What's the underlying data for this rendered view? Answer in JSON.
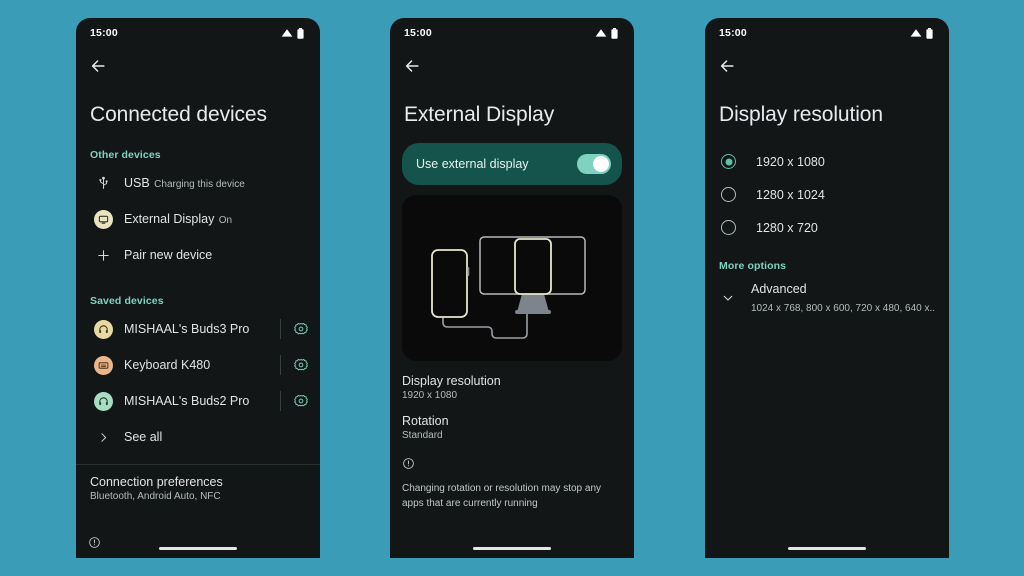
{
  "background_color": "#3a9cb7",
  "theme": {
    "surface": "#121617",
    "accent_teal": "#7fd2c0",
    "card_teal": "#14544c",
    "radio_selected": "#5fbfa8",
    "text_primary": "#e3e3e3",
    "text_secondary": "#b5bcbd"
  },
  "status_bar": {
    "time": "15:00",
    "icons": [
      "wifi-icon",
      "battery-icon"
    ]
  },
  "screens": [
    {
      "id": "connected-devices",
      "back_icon": "back-arrow-icon",
      "title": "Connected devices",
      "sections": [
        {
          "label": "Other devices",
          "rows": [
            {
              "icon": "usb-icon",
              "icon_style": "glyph",
              "title": "USB",
              "subtitle": "Charging this device"
            },
            {
              "icon": "external-display-icon",
              "icon_style": "avatar",
              "avatar_color": "#e9e3c0",
              "title": "External Display",
              "subtitle": "On"
            },
            {
              "icon": "plus-icon",
              "icon_style": "glyph",
              "title": "Pair new device",
              "subtitle": ""
            }
          ]
        },
        {
          "label": "Saved devices",
          "rows": [
            {
              "icon": "headphones-icon",
              "icon_style": "avatar",
              "avatar_color": "#e8d9a0",
              "title": "MISHAAL's Buds3 Pro",
              "subtitle": "",
              "trailing_icon": "gear-icon"
            },
            {
              "icon": "keyboard-icon",
              "icon_style": "avatar",
              "avatar_color": "#eab78a",
              "title": "Keyboard K480",
              "subtitle": "",
              "trailing_icon": "gear-icon"
            },
            {
              "icon": "headphones-icon",
              "icon_style": "avatar",
              "avatar_color": "#a8ddc2",
              "title": "MISHAAL's Buds2 Pro",
              "subtitle": "",
              "trailing_icon": "gear-icon"
            },
            {
              "icon": "chevron-right-icon",
              "icon_style": "glyph",
              "title": "See all",
              "subtitle": ""
            }
          ]
        }
      ],
      "preferences": {
        "title": "Connection preferences",
        "subtitle": "Bluetooth, Android Auto, NFC"
      },
      "corner_icon": "info-icon"
    },
    {
      "id": "external-display",
      "back_icon": "back-arrow-icon",
      "title": "External Display",
      "toggle": {
        "label": "Use external display",
        "state": "on"
      },
      "illustration": "phone-connected-to-monitor-illustration",
      "items": [
        {
          "title": "Display resolution",
          "subtitle": "1920 x 1080"
        },
        {
          "title": "Rotation",
          "subtitle": "Standard"
        }
      ],
      "note": {
        "icon": "info-icon",
        "text": "Changing rotation or resolution may stop any apps that are currently running"
      }
    },
    {
      "id": "display-resolution",
      "back_icon": "back-arrow-icon",
      "title": "Display resolution",
      "options": [
        {
          "label": "1920 x 1080",
          "selected": true
        },
        {
          "label": "1280 x 1024",
          "selected": false
        },
        {
          "label": "1280 x 720",
          "selected": false
        }
      ],
      "more_options_label": "More options",
      "advanced": {
        "chevron_icon": "chevron-down-icon",
        "title": "Advanced",
        "subtitle": "1024 x 768, 800 x 600, 720 x 480, 640 x.."
      }
    }
  ]
}
